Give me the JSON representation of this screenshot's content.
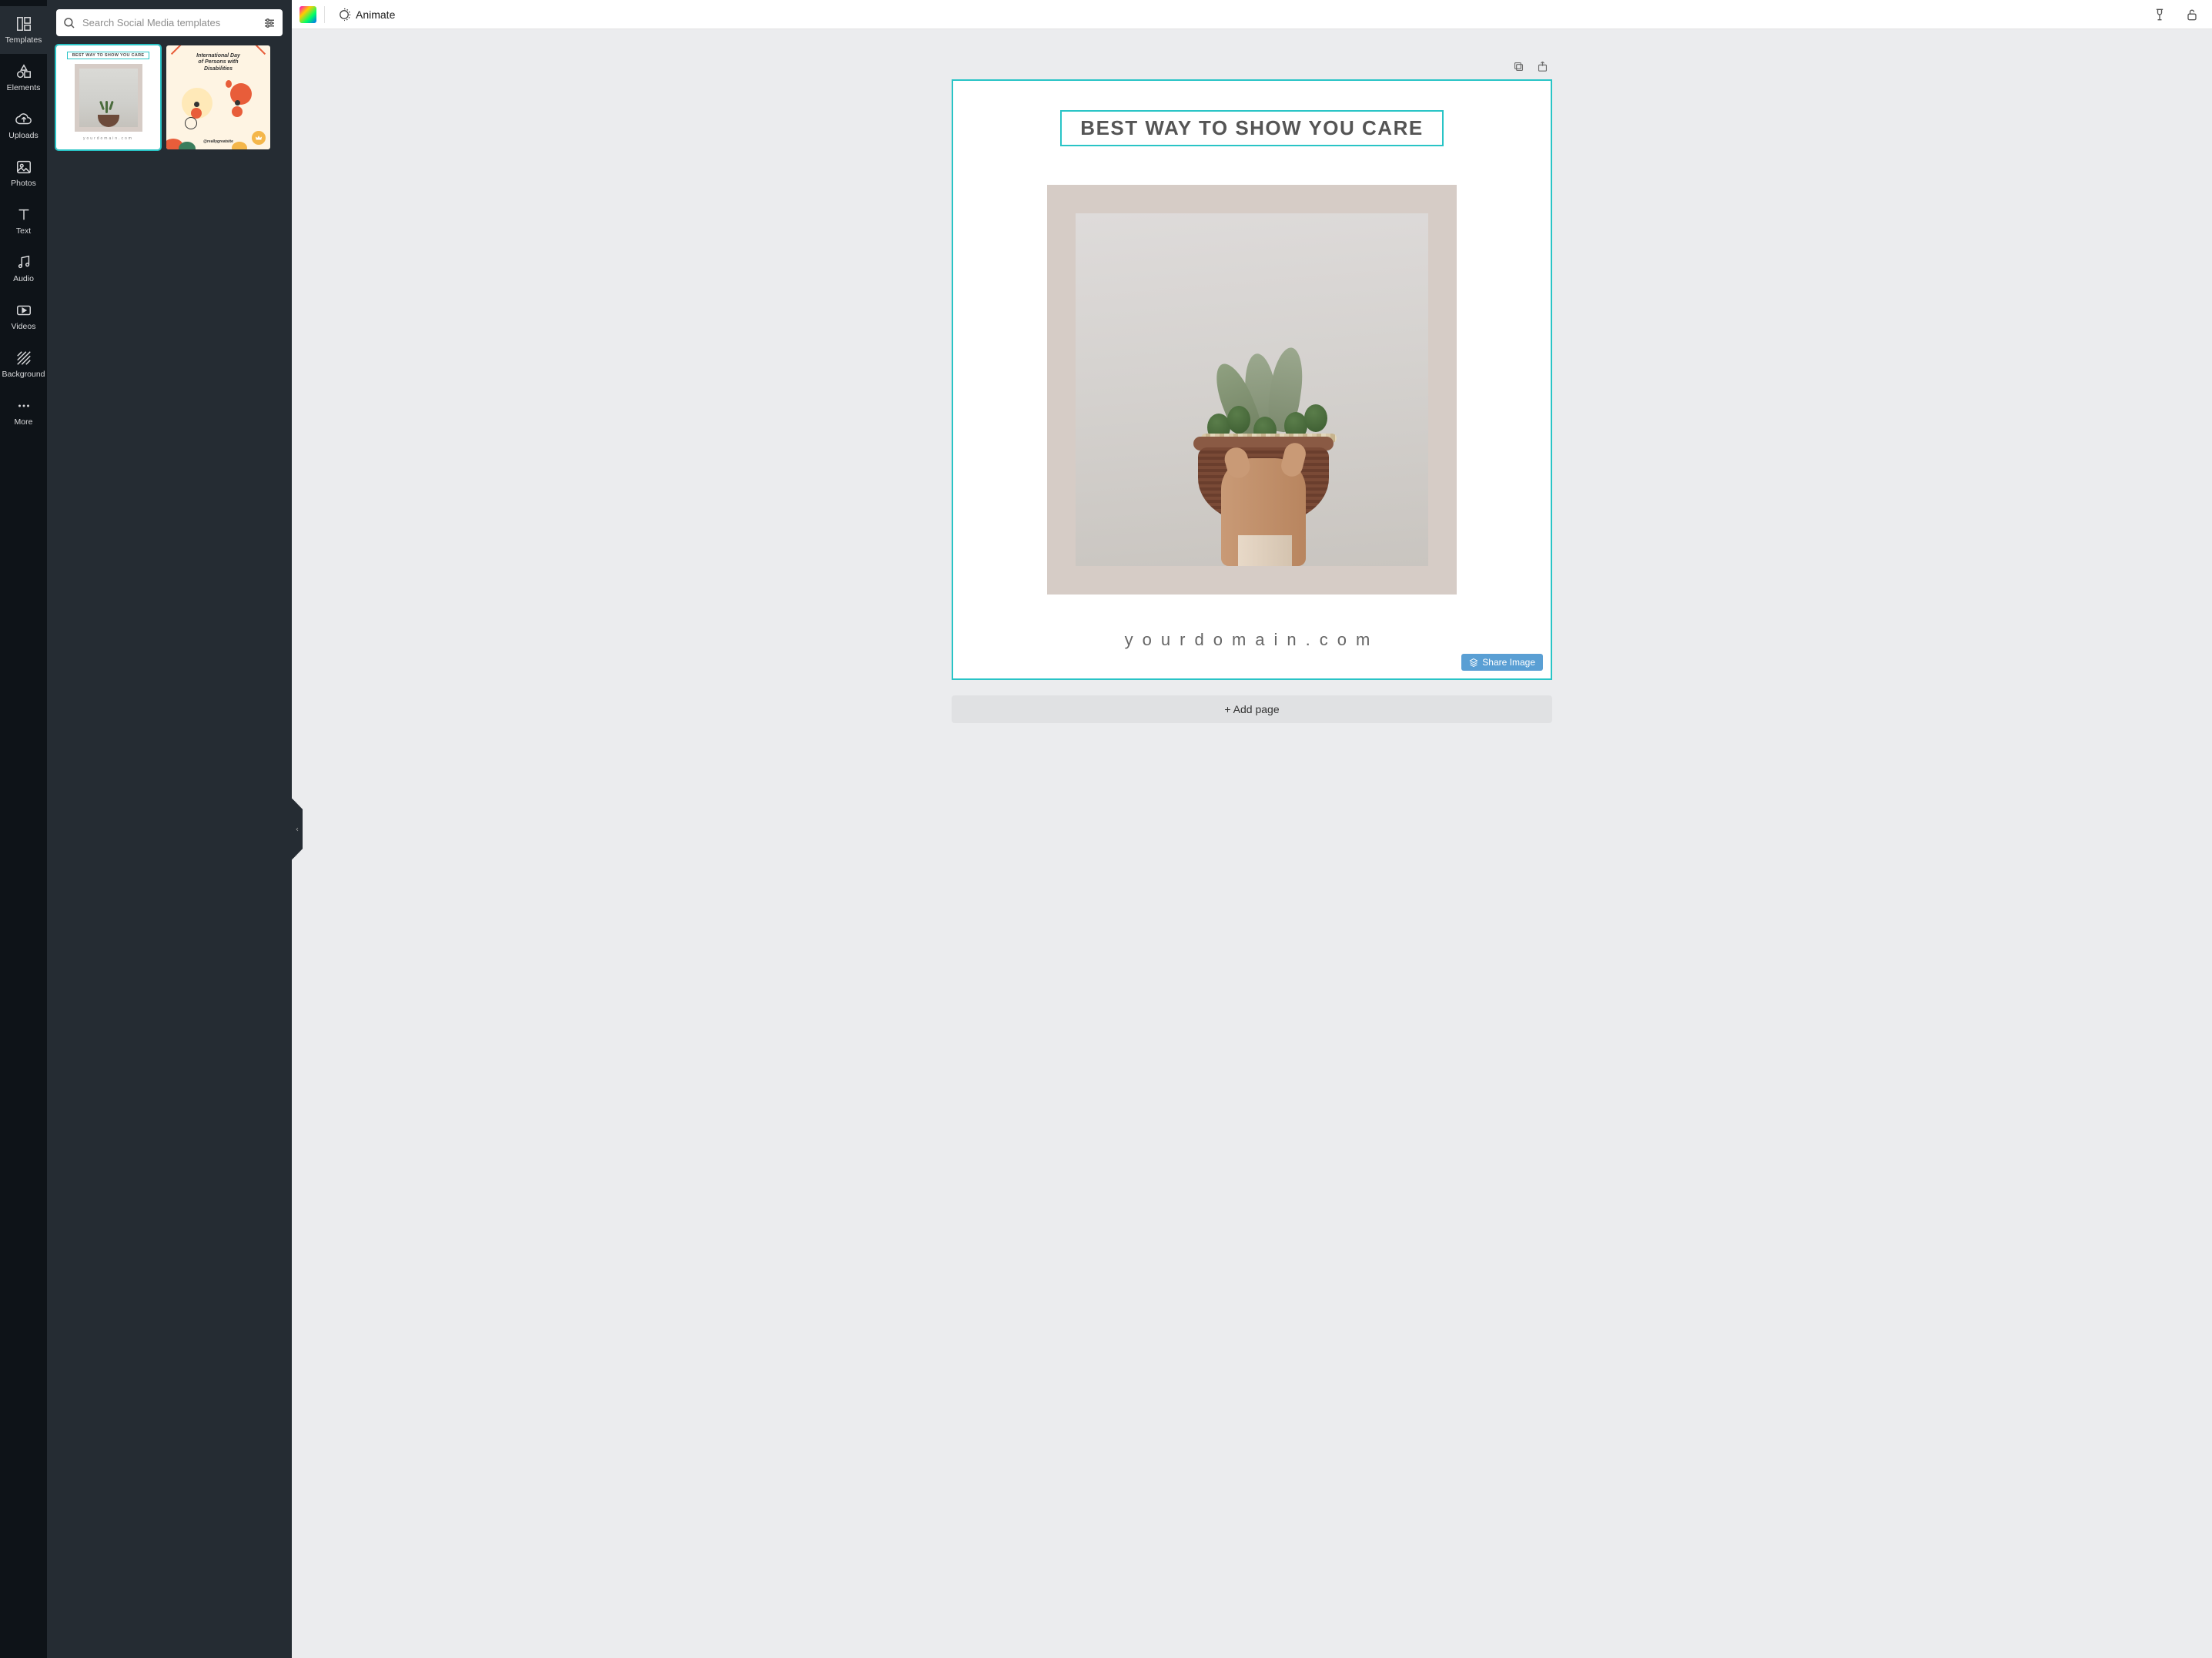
{
  "sidebar": {
    "items": [
      {
        "label": "Templates",
        "icon": "templates-icon"
      },
      {
        "label": "Elements",
        "icon": "elements-icon"
      },
      {
        "label": "Uploads",
        "icon": "uploads-icon"
      },
      {
        "label": "Photos",
        "icon": "photos-icon"
      },
      {
        "label": "Text",
        "icon": "text-icon"
      },
      {
        "label": "Audio",
        "icon": "audio-icon"
      },
      {
        "label": "Videos",
        "icon": "videos-icon"
      },
      {
        "label": "Background",
        "icon": "background-icon"
      },
      {
        "label": "More",
        "icon": "more-icon"
      }
    ],
    "active_index": 0
  },
  "search": {
    "placeholder": "Search Social Media templates"
  },
  "templates": {
    "card1": {
      "title": "BEST WAY TO SHOW YOU CARE",
      "domain": "yourdomain.com"
    },
    "card2": {
      "title_line1": "International Day",
      "title_line2": "of Persons with",
      "title_line3": "Disabilities",
      "subtitle": "@reallygreatsite"
    }
  },
  "topbar": {
    "animate_label": "Animate"
  },
  "canvas": {
    "headline": "BEST WAY TO SHOW YOU CARE",
    "domain_text": "yourdomain.com",
    "share_label": "Share Image",
    "add_page_label": "+ Add page"
  },
  "colors": {
    "selection_border": "#29c4c6",
    "panel_bg": "#252c33",
    "nav_bg": "#0e1318",
    "share_btn": "#5a9fd4"
  }
}
